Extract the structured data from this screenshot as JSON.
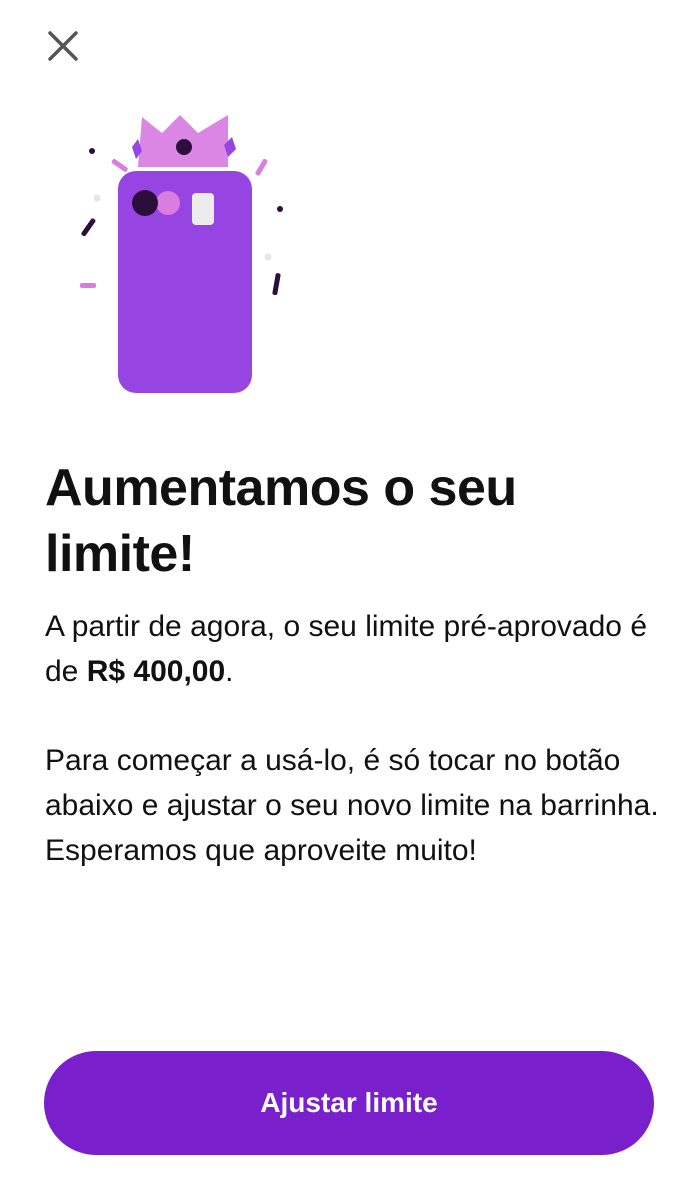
{
  "close": {
    "icon": "close-icon"
  },
  "illustration": {
    "icon": "phone-crown-illustration",
    "colors": {
      "phone": "#9645e3",
      "crown": "#d986e4",
      "accent_dark": "#2b0f3a",
      "accent_pink": "#d97de0"
    }
  },
  "main": {
    "title": "Aumentamos o seu limite!",
    "paragraph1_text": "A partir de agora, o seu limite pré-aprovado é de ",
    "paragraph1_amount": "R$ 400,00",
    "paragraph1_end": ".",
    "paragraph2": "Para começar a usá-lo, é só tocar no botão abaixo e ajustar o seu novo limite na barrinha. Esperamos que aproveite muito!"
  },
  "cta": {
    "label": "Ajustar limite",
    "color": "#7a1fcc"
  }
}
